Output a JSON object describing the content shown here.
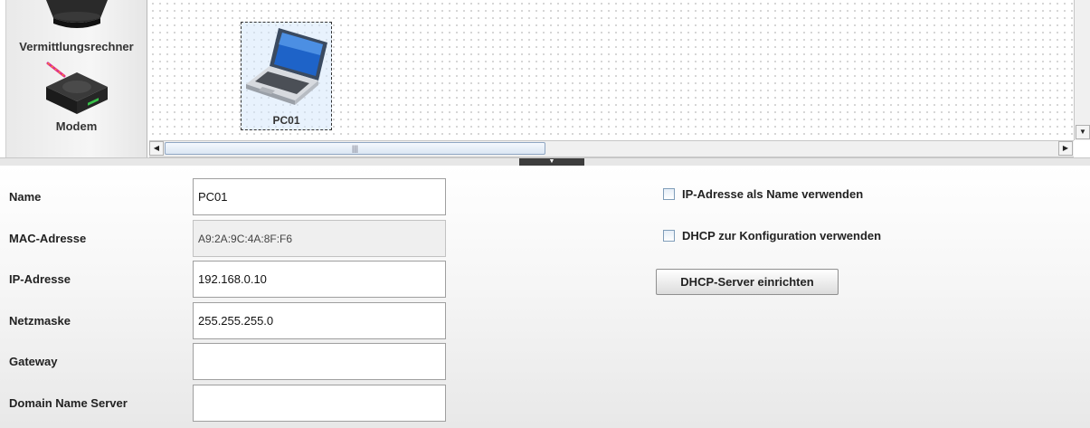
{
  "palette": {
    "items": [
      {
        "label": "Vermittlungsrechner",
        "icon": "switch-icon"
      },
      {
        "label": "Modem",
        "icon": "modem-icon"
      }
    ]
  },
  "canvas": {
    "node": {
      "label": "PC01",
      "icon": "laptop-icon"
    }
  },
  "scroll": {
    "thumb_grip": "|||"
  },
  "form": {
    "fields": [
      {
        "label": "Name",
        "value": "PC01"
      },
      {
        "label": "MAC-Adresse",
        "value": "A9:2A:9C:4A:8F:F6"
      },
      {
        "label": "IP-Adresse",
        "value": "192.168.0.10"
      },
      {
        "label": "Netzmaske",
        "value": "255.255.255.0"
      },
      {
        "label": "Gateway",
        "value": ""
      },
      {
        "label": "Domain Name Server",
        "value": ""
      }
    ],
    "checkboxes": [
      {
        "label": "IP-Adresse als Name verwenden",
        "checked": false
      },
      {
        "label": "DHCP zur Konfiguration verwenden",
        "checked": false
      }
    ],
    "dhcp_button": "DHCP-Server einrichten"
  },
  "colors": {
    "selection": "#d6e8fc",
    "checkbox_border": "#7f9db9"
  }
}
